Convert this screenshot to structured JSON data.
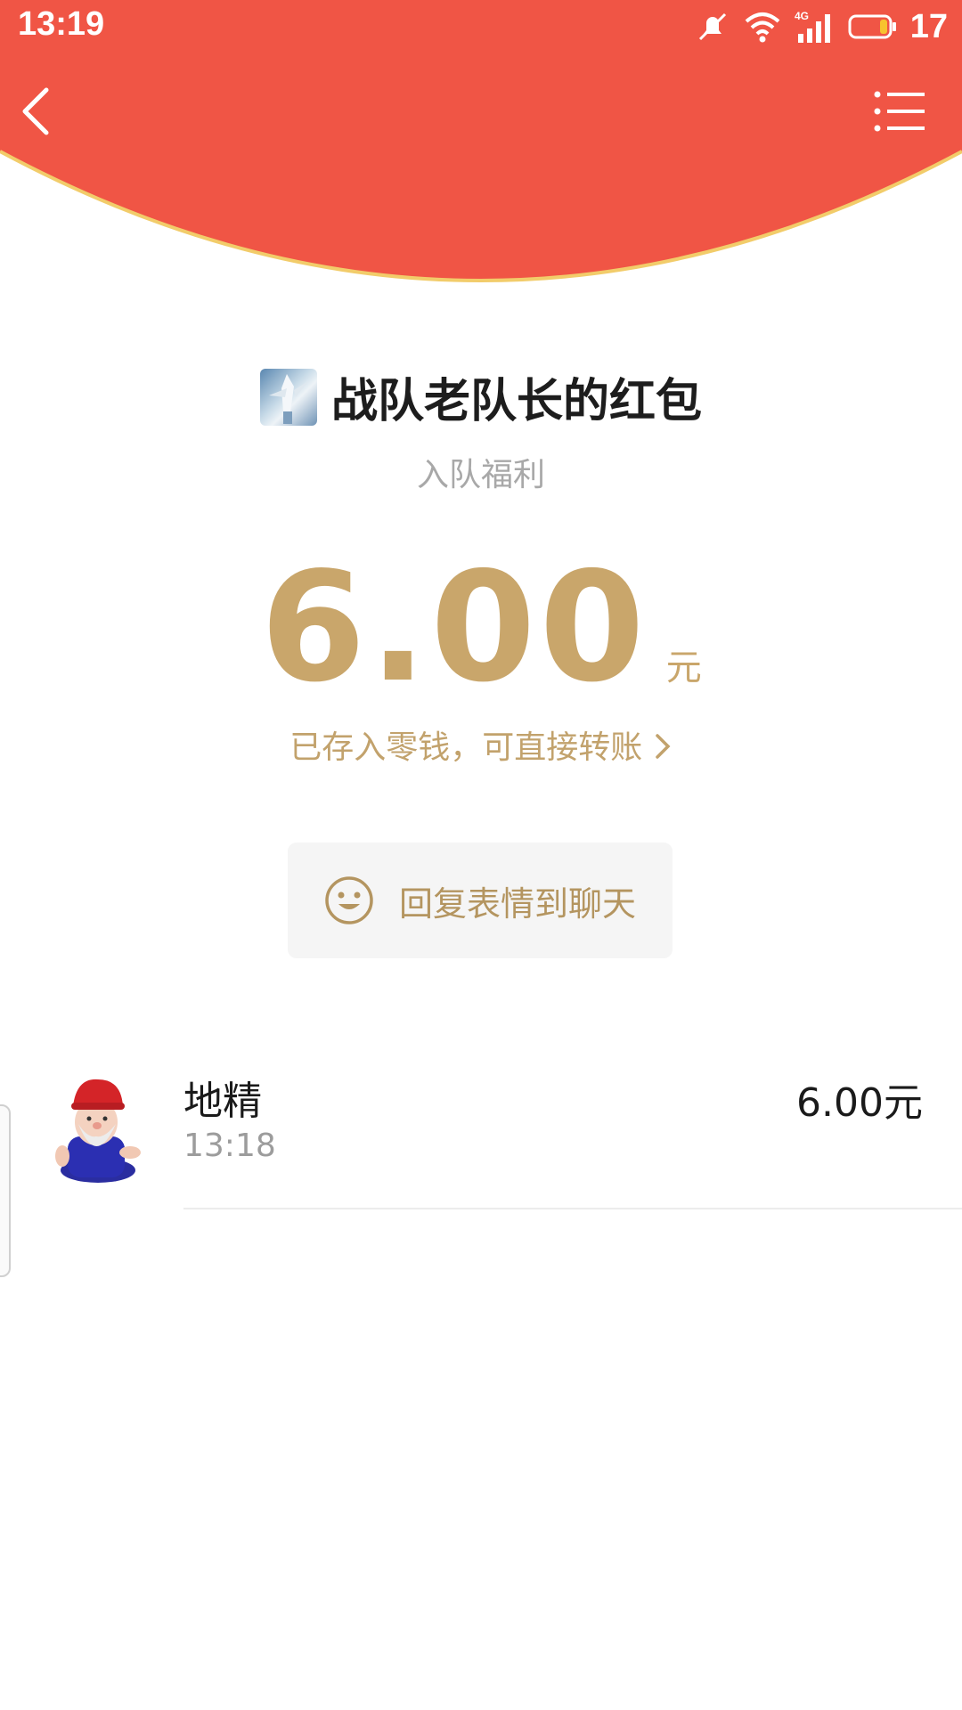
{
  "status_bar": {
    "time": "13:19",
    "network": "4G",
    "battery": "17"
  },
  "header": {
    "back_icon": "chevron-left-icon",
    "menu_icon": "list-menu-icon"
  },
  "packet": {
    "title": "战队老队长的红包",
    "subtitle": "入队福利",
    "amount": "6.00",
    "unit": "元",
    "deposit_text": "已存入零钱，可直接转账",
    "reply_label": "回复表情到聊天"
  },
  "records": [
    {
      "name": "地精",
      "time": "13:18",
      "amount": "6.00元"
    }
  ],
  "colors": {
    "header_red": "#f05545",
    "gold": "#c9a66b",
    "rim": "#f2cc6a"
  }
}
